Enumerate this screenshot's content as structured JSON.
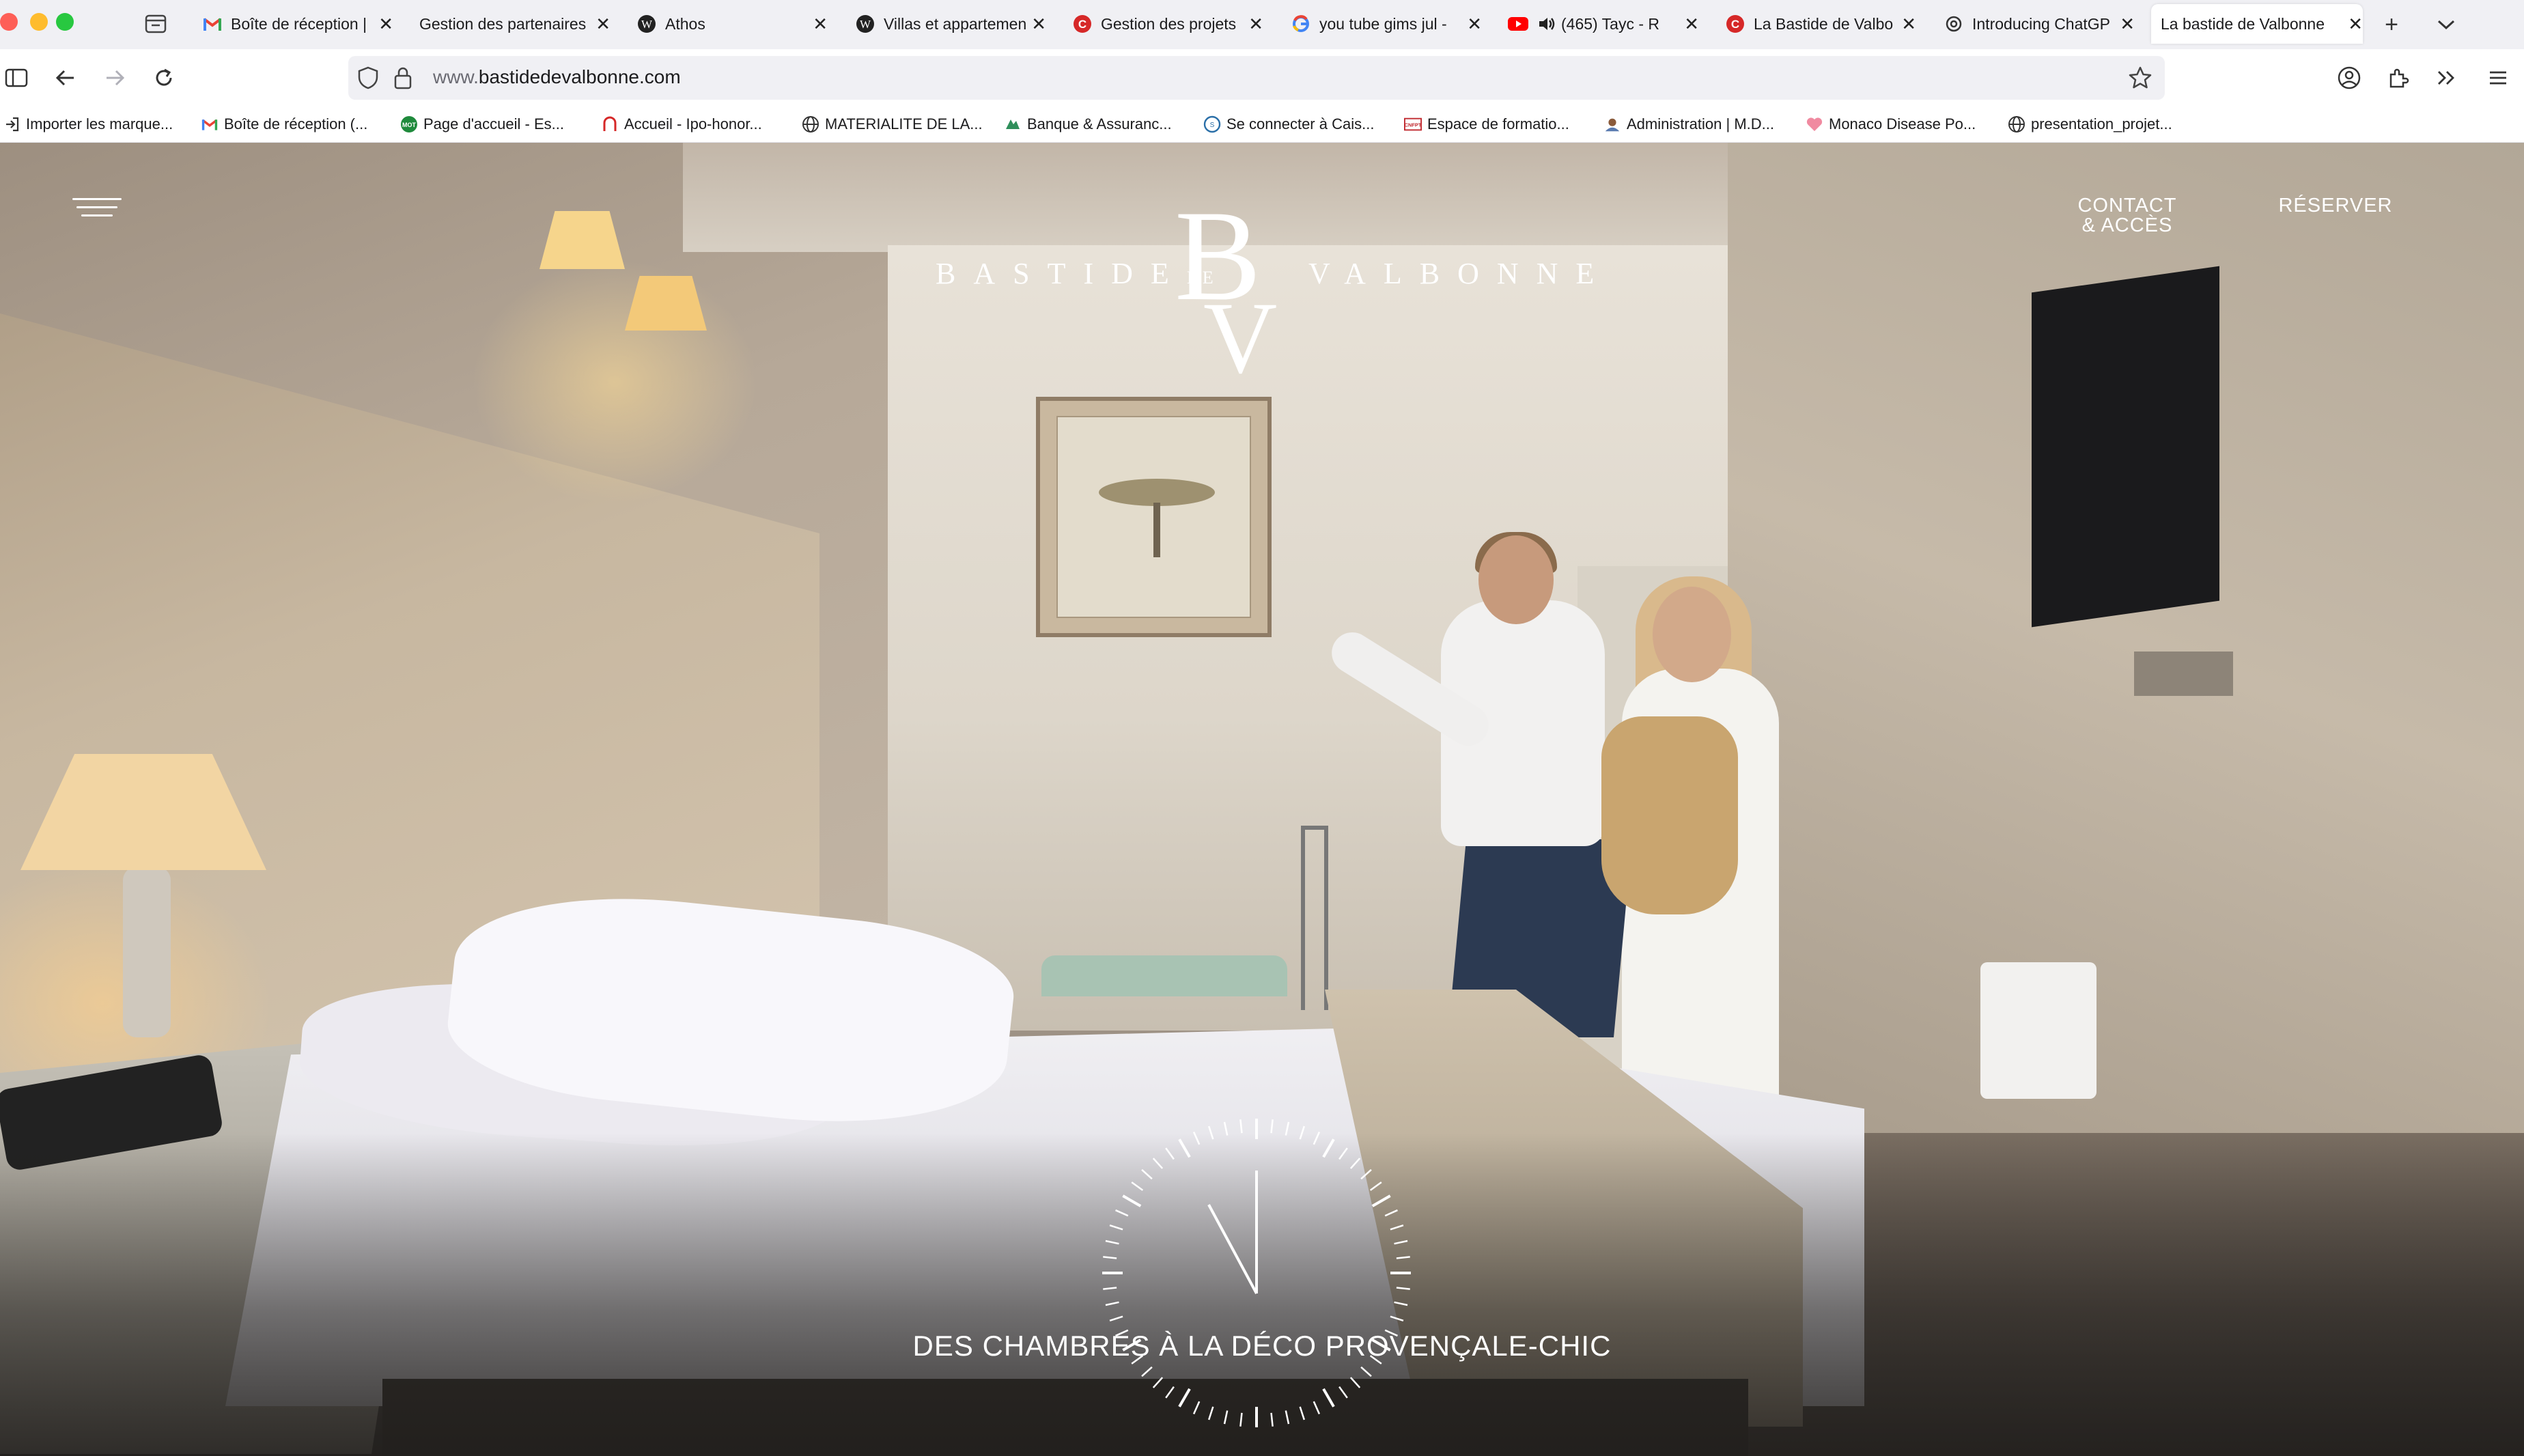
{
  "browser": {
    "tabs": [
      {
        "title": "Boîte de réception |",
        "icon": "gmail-icon"
      },
      {
        "title": "Gestion des partenaires",
        "icon": "none"
      },
      {
        "title": "Athos",
        "icon": "wordpress-icon"
      },
      {
        "title": "Villas et appartemen",
        "icon": "wordpress-icon"
      },
      {
        "title": "Gestion des projets",
        "icon": "red-c-icon"
      },
      {
        "title": "you tube gims jul -",
        "icon": "google-icon"
      },
      {
        "title": "(465) Tayc - R",
        "icon": "youtube-icon"
      },
      {
        "title": "La Bastide de Valbo",
        "icon": "red-c-icon"
      },
      {
        "title": "Introducing ChatGP",
        "icon": "openai-icon"
      },
      {
        "title": "La bastide de Valbonne",
        "icon": "none"
      }
    ],
    "active_tab_index": 9,
    "url": {
      "prefix": "www.",
      "host": "bastidedevalbonne.com"
    },
    "bookmarks": [
      {
        "label": "Importer les marque...",
        "icon": "import-icon"
      },
      {
        "label": "Boîte de réception (...",
        "icon": "gmail-icon"
      },
      {
        "label": "Page d'accueil - Es...",
        "icon": "mot-icon"
      },
      {
        "label": "Accueil - Ipo-honor...",
        "icon": "red-a-icon"
      },
      {
        "label": "MATERIALITE DE LA...",
        "icon": "globe-icon"
      },
      {
        "label": "Banque & Assuranc...",
        "icon": "bank-icon"
      },
      {
        "label": "Se connecter à Cais...",
        "icon": "caisse-icon"
      },
      {
        "label": "Espace de formatio...",
        "icon": "cnfpt-icon"
      },
      {
        "label": "Administration | M.D...",
        "icon": "admin-icon"
      },
      {
        "label": "Monaco Disease Po...",
        "icon": "heart-icon"
      },
      {
        "label": "presentation_projet...",
        "icon": "globe-icon"
      }
    ],
    "colors": {
      "tab_strip": "#f0f0f4",
      "toolbar": "#ffffff",
      "accent_red": "#fe5f57"
    }
  },
  "site": {
    "logo": {
      "left": "BASTIDE",
      "right": "VALBONNE",
      "monogram_b": "B",
      "monogram_de": "DE",
      "monogram_v": "V"
    },
    "nav": {
      "contact_line1": "CONTACT",
      "contact_line2": "& ACCÈS",
      "reserve": "RÉSERVER"
    },
    "caption": "DES CHAMBRES À LA DÉCO PROVENÇALE-CHIC"
  }
}
